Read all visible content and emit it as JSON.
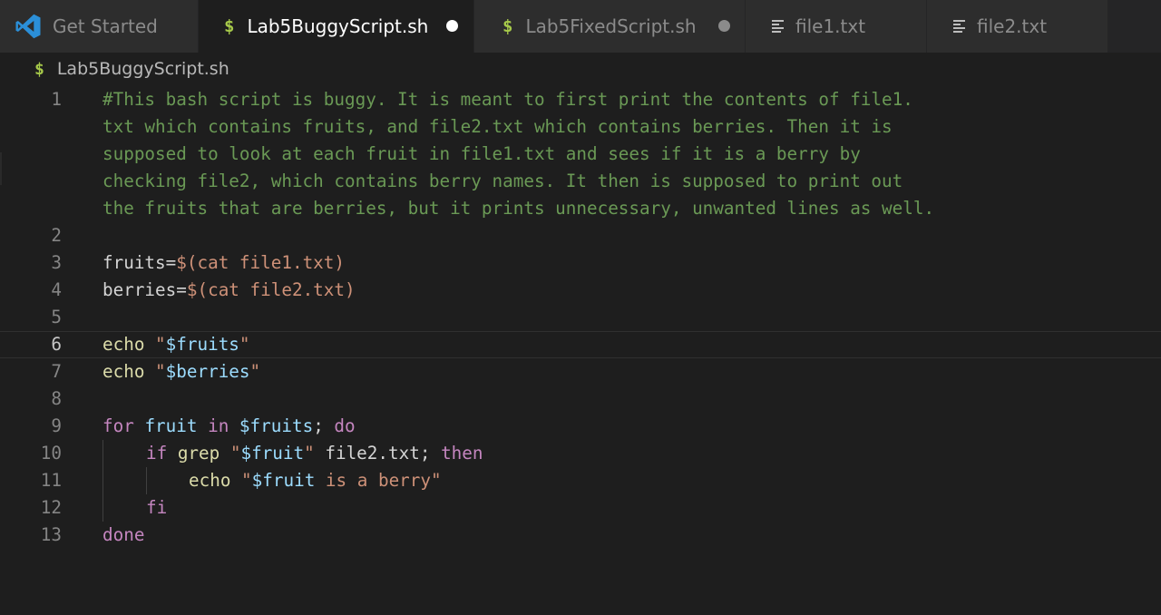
{
  "tabs": [
    {
      "label": "Get Started",
      "icon": "vscode-logo-icon",
      "active": false,
      "modified": false
    },
    {
      "label": "Lab5BuggyScript.sh",
      "icon": "shell-dollar-icon",
      "active": true,
      "modified": true
    },
    {
      "label": "Lab5FixedScript.sh",
      "icon": "shell-dollar-icon",
      "active": false,
      "modified": true
    },
    {
      "label": "file1.txt",
      "icon": "text-file-icon",
      "active": false,
      "modified": false
    },
    {
      "label": "file2.txt",
      "icon": "text-file-icon",
      "active": false,
      "modified": false
    }
  ],
  "icons": {
    "shell": "$"
  },
  "breadcrumb": {
    "file": "Lab5BuggyScript.sh"
  },
  "editor": {
    "active_line": 6,
    "line_numbers": [
      "1",
      "2",
      "3",
      "4",
      "5",
      "6",
      "7",
      "8",
      "9",
      "10",
      "11",
      "12",
      "13"
    ],
    "comment_lines": [
      "#This bash script is buggy. It is meant to first print the contents of file1.",
      "txt which contains fruits, and file2.txt which contains berries. Then it is",
      "supposed to look at each fruit in file1.txt and sees if it is a berry by",
      "checking file2, which contains berry names. It then is supposed to print out",
      "the fruits that are berries, but it prints unnecessary, unwanted lines as well."
    ],
    "line3": {
      "name": "fruits",
      "eq": "=",
      "sub": "$(cat file1.txt)"
    },
    "line4": {
      "name": "berries",
      "eq": "=",
      "sub": "$(cat file2.txt)"
    },
    "line6": {
      "cmd": "echo",
      "q1": "\"",
      "var": "$fruits",
      "q2": "\""
    },
    "line7": {
      "cmd": "echo",
      "q1": "\"",
      "var": "$berries",
      "q2": "\""
    },
    "line9": {
      "kw1": "for",
      "var1": "fruit",
      "kw2": "in",
      "var2": "$fruits",
      "semi": ";",
      "kw3": "do"
    },
    "line10": {
      "kw1": "if",
      "cmd": "grep",
      "q1": "\"",
      "var": "$fruit",
      "q2": "\"",
      "arg": "file2.txt;",
      "kw2": "then"
    },
    "line11": {
      "cmd": "echo",
      "q1": "\"",
      "var": "$fruit",
      "str": " is a berry\""
    },
    "line12": {
      "kw": "fi"
    },
    "line13": {
      "kw": "done"
    }
  },
  "colors": {
    "background": "#1e1e1e",
    "tab_inactive": "#2d2d2d",
    "tab_active": "#1e1e1e",
    "comment": "#6a9955",
    "variable": "#9cdcfe",
    "string": "#ce9178",
    "keyword": "#c586c0",
    "function": "#dcdcaa",
    "shell_icon": "#a6c94a",
    "vscode_blue": "#2b8fd8"
  }
}
